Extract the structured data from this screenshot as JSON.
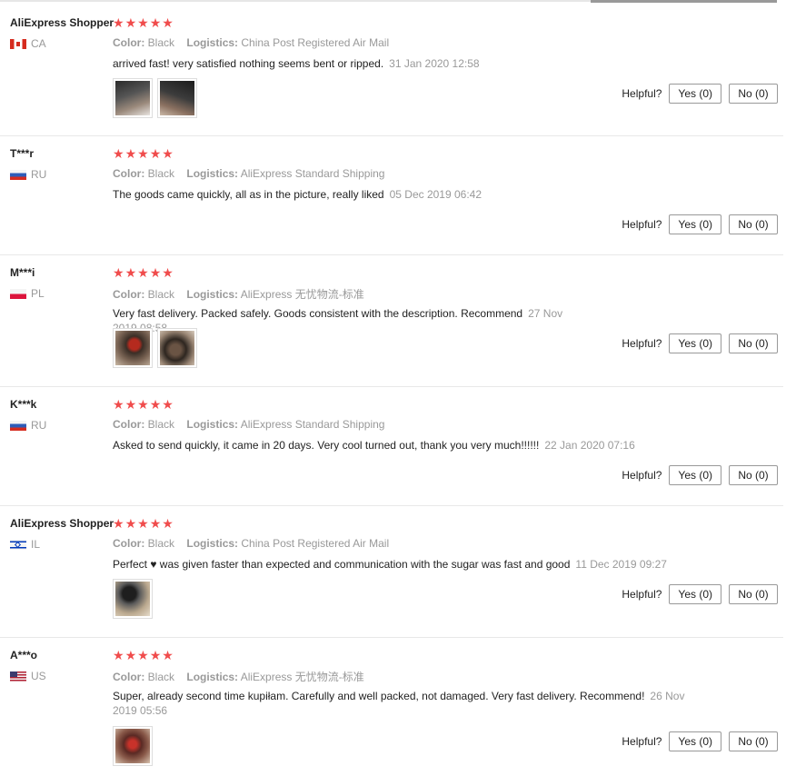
{
  "labels": {
    "color": "Color:",
    "logistics": "Logistics:",
    "helpful": "Helpful?"
  },
  "reviews": [
    {
      "user": "AliExpress Shopper",
      "country": "CA",
      "color": "Black",
      "logistics": "China Post Registered Air Mail",
      "text": "arrived fast! very satisfied nothing seems bent or ripped.",
      "date": "31 Jan 2020 12:58",
      "rating": 5,
      "photos": [
        "photo-1",
        "photo-2"
      ],
      "yes": "Yes (0)",
      "no": "No (0)"
    },
    {
      "user": "T***r",
      "country": "RU",
      "color": "Black",
      "logistics": "AliExpress Standard Shipping",
      "text": "The goods came quickly, all as in the picture, really liked",
      "date": "05 Dec 2019 06:42",
      "rating": 5,
      "photos": [],
      "yes": "Yes (0)",
      "no": "No (0)"
    },
    {
      "user": "M***i",
      "country": "PL",
      "color": "Black",
      "logistics": "AliExpress 无忧物流-标准",
      "text": "Very fast delivery. Packed safely. Goods consistent with the description. Recommend",
      "date": "27 Nov 2019 08:58",
      "rating": 5,
      "photos": [
        "photo-1",
        "photo-2"
      ],
      "yes": "Yes (0)",
      "no": "No (0)"
    },
    {
      "user": "K***k",
      "country": "RU",
      "color": "Black",
      "logistics": "AliExpress Standard Shipping",
      "text": "Asked to send quickly, it came in 20 days. Very cool turned out, thank you very much!!!!!!",
      "date": "22 Jan 2020 07:16",
      "rating": 5,
      "photos": [],
      "yes": "Yes (0)",
      "no": "No (0)"
    },
    {
      "user": "AliExpress Shopper",
      "country": "IL",
      "color": "Black",
      "logistics": "China Post Registered Air Mail",
      "text": "Perfect ♥  was given faster than expected and communication with the sugar was fast and good",
      "date": "11 Dec 2019 09:27",
      "rating": 5,
      "photos": [
        "photo-1"
      ],
      "yes": "Yes (0)",
      "no": "No (0)"
    },
    {
      "user": "A***o",
      "country": "US",
      "color": "Black",
      "logistics": "AliExpress 无忧物流-标准",
      "text": "Super, already second time kupiłam. Carefully and well packed, not damaged. Very fast delivery. Recommend!",
      "date": "26 Nov 2019 05:56",
      "rating": 5,
      "photos": [
        "photo-1"
      ],
      "yes": "Yes (0)",
      "no": "No (0)"
    }
  ],
  "colors": {
    "star": "#f04c4c",
    "muted": "#999999",
    "text": "#222222"
  }
}
